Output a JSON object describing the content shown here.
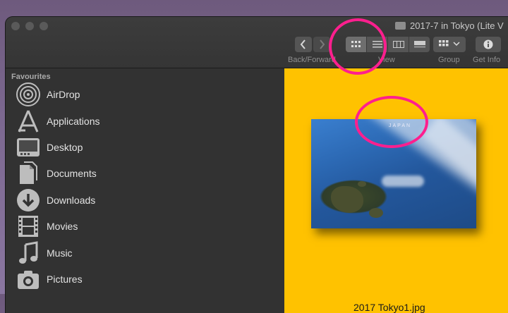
{
  "window": {
    "title": "2017-7 in Tokyo (Lite V",
    "folder_icon": "folder-icon"
  },
  "toolbar": {
    "back_forward_label": "Back/Forward",
    "back_icon": "chevron-left-icon",
    "forward_icon": "chevron-right-icon",
    "view_label": "View",
    "view_modes": [
      "icon-view-icon",
      "list-view-icon",
      "column-view-icon",
      "gallery-view-icon"
    ],
    "active_view": "icon-view-icon",
    "group_label": "Group",
    "group_icon": "grid-dropdown-icon",
    "get_info_label": "Get Info",
    "get_info_icon": "info-icon"
  },
  "sidebar": {
    "section_title": "Favourites",
    "items": [
      {
        "label": "AirDrop",
        "icon": "airdrop-icon"
      },
      {
        "label": "Applications",
        "icon": "applications-icon"
      },
      {
        "label": "Desktop",
        "icon": "desktop-icon"
      },
      {
        "label": "Documents",
        "icon": "documents-icon"
      },
      {
        "label": "Downloads",
        "icon": "downloads-icon"
      },
      {
        "label": "Movies",
        "icon": "movies-icon"
      },
      {
        "label": "Music",
        "icon": "music-icon"
      },
      {
        "label": "Pictures",
        "icon": "pictures-icon"
      }
    ]
  },
  "preview": {
    "filename": "2017 Tokyo1.jpg",
    "photo_title": "JAPAN",
    "background": "#ffc200"
  },
  "annotation_color": "#ff1f8e"
}
